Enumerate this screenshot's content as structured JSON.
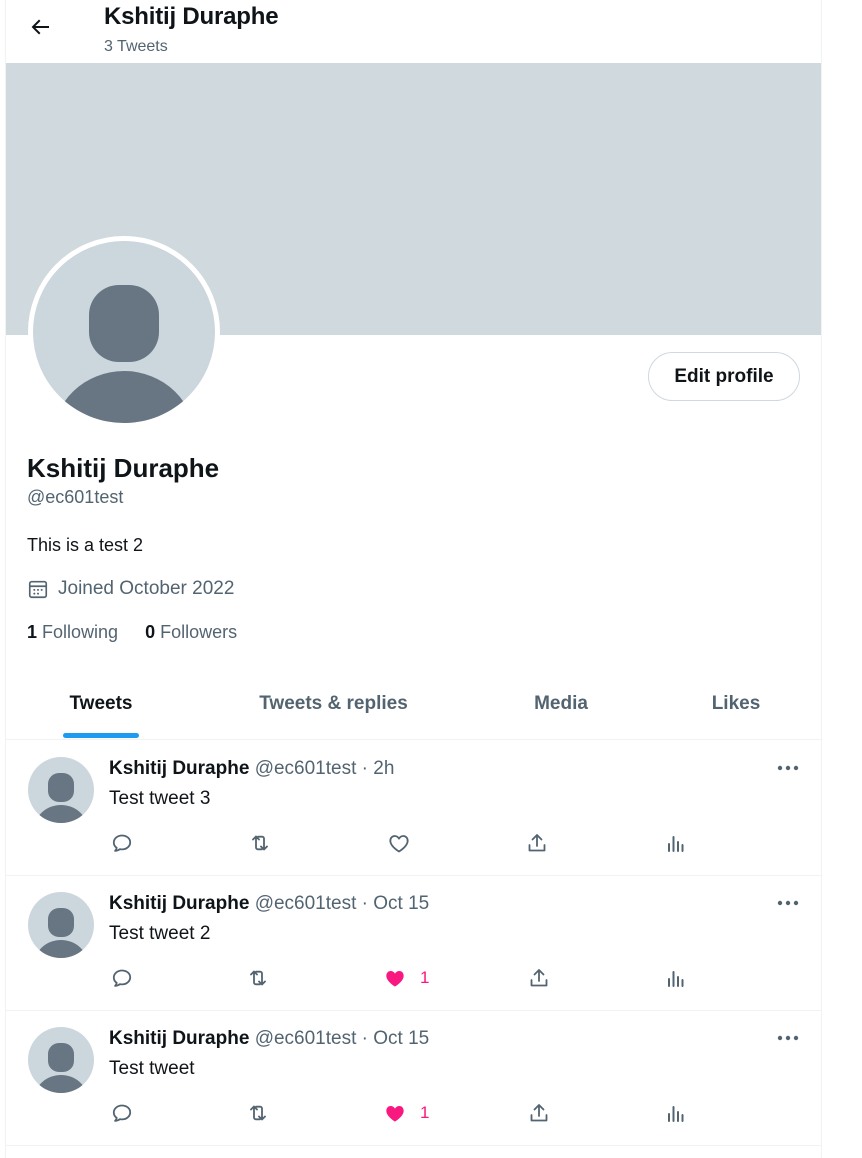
{
  "header": {
    "name": "Kshitij Duraphe",
    "tweet_count": "3 Tweets"
  },
  "profile": {
    "name": "Kshitij Duraphe",
    "handle": "@ec601test",
    "bio": "This is a test 2",
    "joined": "Joined October 2022",
    "following_count": "1",
    "following_label": "Following",
    "followers_count": "0",
    "followers_label": "Followers",
    "edit_label": "Edit profile"
  },
  "tabs": [
    {
      "label": "Tweets",
      "active": true
    },
    {
      "label": "Tweets & replies",
      "active": false
    },
    {
      "label": "Media",
      "active": false
    },
    {
      "label": "Likes",
      "active": false
    }
  ],
  "tweets": [
    {
      "name": "Kshitij Duraphe",
      "handle": "@ec601test",
      "dot": "·",
      "time": "2h",
      "text": "Test tweet 3",
      "liked": false,
      "likes": ""
    },
    {
      "name": "Kshitij Duraphe",
      "handle": "@ec601test",
      "dot": "·",
      "time": "Oct 15",
      "text": "Test tweet 2",
      "liked": true,
      "likes": "1"
    },
    {
      "name": "Kshitij Duraphe",
      "handle": "@ec601test",
      "dot": "·",
      "time": "Oct 15",
      "text": "Test tweet",
      "liked": true,
      "likes": "1"
    }
  ],
  "colors": {
    "banner": "#cfd9de",
    "accent": "#1d9bf0",
    "like": "#f91880",
    "muted": "#536471",
    "avatar_bg": "#ccd6dd",
    "avatar_fg": "#687684"
  },
  "icons": {
    "back": "arrow-left-icon",
    "calendar": "calendar-icon",
    "more": "more-dots-icon",
    "reply": "reply-icon",
    "retweet": "retweet-icon",
    "like": "heart-icon",
    "share": "share-icon",
    "analytics": "analytics-icon"
  }
}
